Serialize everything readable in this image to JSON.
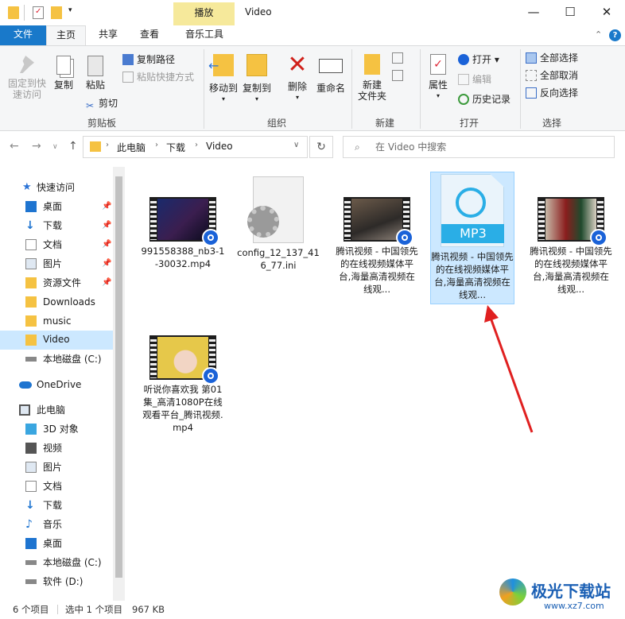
{
  "window": {
    "title": "Video",
    "context_tab": "播放",
    "controls": {
      "minimize": "—",
      "maximize": "☐",
      "close": "✕"
    }
  },
  "tabs": [
    {
      "label": "文件"
    },
    {
      "label": "主页"
    },
    {
      "label": "共享"
    },
    {
      "label": "查看"
    },
    {
      "label": "音乐工具"
    }
  ],
  "ribbon": {
    "clipboard": {
      "pin": "固定到快\n速访问",
      "copy": "复制",
      "paste": "粘贴",
      "copy_path": "复制路径",
      "paste_shortcut": "粘贴快捷方式",
      "cut": "剪切",
      "group": "剪贴板"
    },
    "organize": {
      "move_to": "移动到",
      "copy_to": "复制到",
      "delete": "删除",
      "rename": "重命名",
      "group": "组织"
    },
    "new": {
      "new_folder": "新建\n文件夹",
      "group": "新建"
    },
    "open": {
      "properties": "属性",
      "open": "打开",
      "edit": "编辑",
      "history": "历史记录",
      "group": "打开"
    },
    "select": {
      "select_all": "全部选择",
      "select_none": "全部取消",
      "invert": "反向选择",
      "group": "选择"
    }
  },
  "address": {
    "path": [
      "此电脑",
      "下载",
      "Video"
    ],
    "search_placeholder": "在 Video 中搜索"
  },
  "sidebar": {
    "quick_access": "快速访问",
    "items": [
      {
        "label": "桌面",
        "pinned": true
      },
      {
        "label": "下载",
        "pinned": true
      },
      {
        "label": "文档",
        "pinned": true
      },
      {
        "label": "图片",
        "pinned": true
      },
      {
        "label": "资源文件",
        "pinned": true
      },
      {
        "label": "Downloads",
        "pinned": false
      },
      {
        "label": "music",
        "pinned": false
      },
      {
        "label": "Video",
        "pinned": false,
        "selected": true
      },
      {
        "label": "本地磁盘 (C:)",
        "pinned": false
      }
    ],
    "onedrive": "OneDrive",
    "this_pc": "此电脑",
    "pc_items": [
      {
        "label": "3D 对象"
      },
      {
        "label": "视频"
      },
      {
        "label": "图片"
      },
      {
        "label": "文档"
      },
      {
        "label": "下载"
      },
      {
        "label": "音乐"
      },
      {
        "label": "桌面"
      },
      {
        "label": "本地磁盘 (C:)"
      },
      {
        "label": "软件 (D:)"
      }
    ]
  },
  "files": [
    {
      "name": "991558388_nb3-1-30032.mp4",
      "kind": "video"
    },
    {
      "name": "config_12_137_416_77.ini",
      "kind": "settings"
    },
    {
      "name": "腾讯视频 - 中国领先的在线视频媒体平台,海量高清视频在线观...",
      "kind": "video"
    },
    {
      "name": "腾讯视频 - 中国领先的在线视频媒体平台,海量高清视频在线观...",
      "kind": "mp3",
      "selected": true,
      "badge": "MP3"
    },
    {
      "name": "腾讯视频 - 中国领先的在线视频媒体平台,海量高清视频在线观...",
      "kind": "video"
    },
    {
      "name": "听说你喜欢我 第01集_高清1080P在线观看平台_腾讯视频.mp4",
      "kind": "video"
    }
  ],
  "status": {
    "count": "6 个项目",
    "selected": "选中 1 个项目",
    "size": "967 KB"
  },
  "watermark": {
    "text": "极光下载站",
    "url": "www.xz7.com"
  },
  "colors": {
    "file_tab": "#1979ca",
    "context_tab": "#f6e99b",
    "selection": "#cce8ff",
    "arrow": "#e02020"
  }
}
